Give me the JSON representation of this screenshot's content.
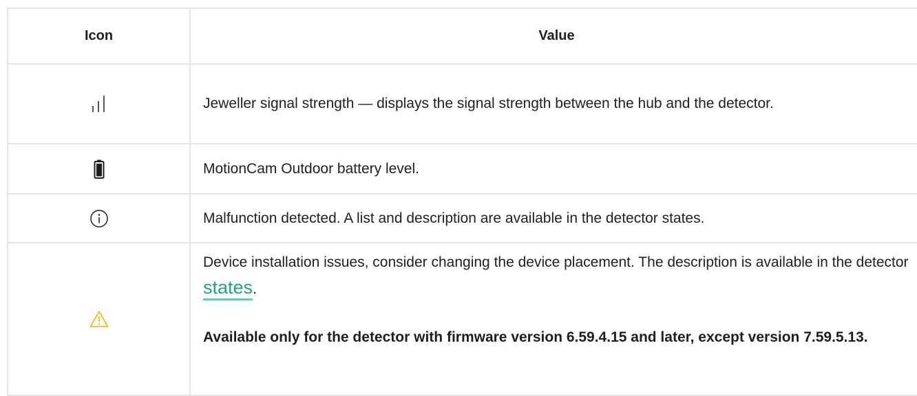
{
  "table": {
    "headers": {
      "icon": "Icon",
      "value": "Value"
    },
    "rows": [
      {
        "icon": "signal-strength-icon",
        "text": "Jeweller signal strength — displays the signal strength between the hub and the detector."
      },
      {
        "icon": "battery-icon",
        "text": "MotionCam Outdoor battery level."
      },
      {
        "icon": "info-circle-icon",
        "text": "Malfunction detected. A list and description are available in the detector states."
      },
      {
        "icon": "warning-triangle-icon",
        "text_before_link": "Device installation issues, consider changing the device placement. The description is available in the detector ",
        "link_text": "states",
        "text_after_link": ".",
        "note": "Available only for the detector with firmware version 6.59.4.15 and later, except version 7.59.5.13."
      }
    ]
  },
  "colors": {
    "border": "#e5e5e5",
    "text": "#1f1f1f",
    "link": "#1fa67a",
    "link_underline": "#58d6a9",
    "warning": "#f2b200"
  }
}
